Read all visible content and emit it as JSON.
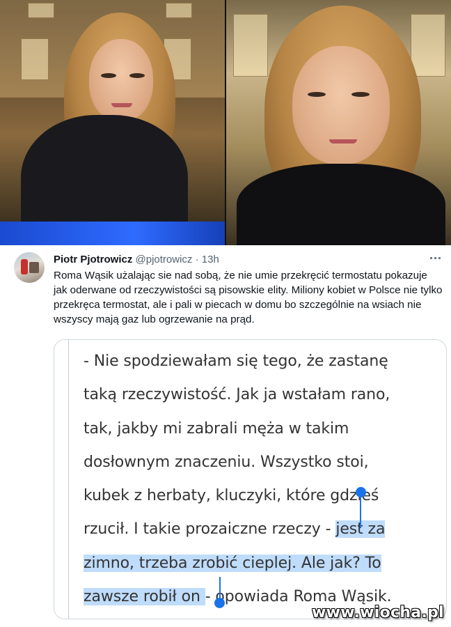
{
  "tweet": {
    "author_name": "Piotr Pjotrowicz",
    "handle": "@pjotrowicz",
    "separator": "·",
    "time": "13h",
    "text": "Roma Wąsik użalając sie nad sobą, że nie umie przekręcić termostatu pokazuje jak oderwane od rzeczywistości są pisowskie elity. Miliony kobiet w Polsce nie tylko przekręca termostat, ale i pali w piecach w domu bo szczególnie na wsiach nie wszyscy mają gaz lub ogrzewanie na prąd.",
    "more_icon": "more-horizontal-icon"
  },
  "quote_image": {
    "lines": [
      "- Nie spodziewałam się tego, że zastanę",
      "taką rzeczywistość. Jak ja wstałam rano,",
      "tak, jakby mi zabrali męża w takim",
      "dosłownym znaczeniu. Wszystko stoi,",
      "kubek z herbaty, kluczyki, które gdzieś"
    ],
    "line6_plain": "rzucił. I takie prozaiczne rzeczy - ",
    "line6_selected": "jest za",
    "line7_selected": "zimno, trzeba zrobić cieplej. Ale jak? To",
    "line8_selected": "zawsze robił on ",
    "line8_plain": "- opowiada Roma Wąsik.",
    "selection_color": "#bfdcfb",
    "caret_color": "#1a73e8"
  },
  "watermark": "www.wiocha.pl"
}
